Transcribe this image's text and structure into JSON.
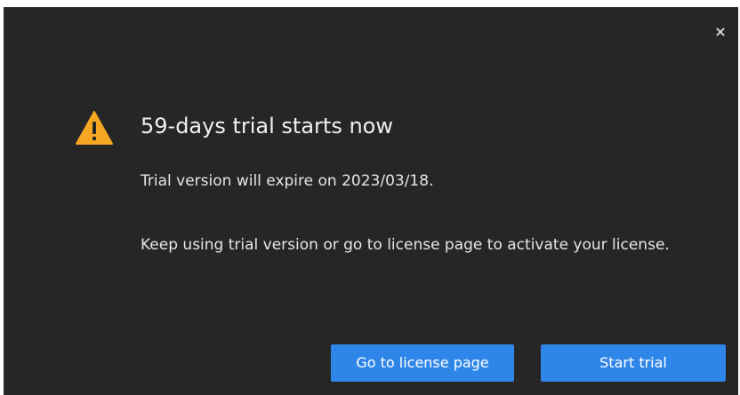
{
  "dialog": {
    "close_glyph": "×",
    "icon": "warning-triangle-icon",
    "icon_color": "#f5a623",
    "title": "59-days trial starts now",
    "expire_text": "Trial version will expire on 2023/03/18.",
    "instruction_text": "Keep using trial version or go to license page to activate your license.",
    "buttons": {
      "license_label": "Go to license page",
      "trial_label": "Start trial"
    },
    "accent_color": "#2f86e9",
    "background_color": "#262626"
  }
}
